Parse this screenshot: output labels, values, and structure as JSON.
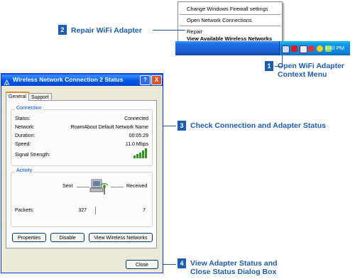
{
  "context_menu": {
    "items": [
      {
        "label": "Change Windows Firewall settings",
        "bold": false
      },
      {
        "label": "Open Network Connections",
        "bold": false
      },
      {
        "label": "Repair",
        "bold": false
      },
      {
        "label": "View Available Wireless Networks",
        "bold": true
      }
    ]
  },
  "taskbar": {
    "clock": "3:40 PM"
  },
  "callouts": [
    {
      "number": "1",
      "text_line1": "Open WiFi Adapter",
      "text_line2": "Context Menu"
    },
    {
      "number": "2",
      "text_line1": "Repair WiFi Adapter"
    },
    {
      "number": "3",
      "text_line1": "Check Connection and Adapter Status"
    },
    {
      "number": "4",
      "text_line1": "View Adapter Status and",
      "text_line2": "Close Status Dialog Box"
    }
  ],
  "dialog": {
    "title": "Wireless Network Connection 2 Status",
    "title_buttons": {
      "help": "?",
      "close": "X"
    },
    "tabs": [
      "General",
      "Support"
    ],
    "connection": {
      "group_title": "Connection",
      "rows": [
        {
          "label": "Status:",
          "value": "Connected"
        },
        {
          "label": "Network:",
          "value": "RoamAbout Default Network Name"
        },
        {
          "label": "Duration:",
          "value": "00:05:29"
        },
        {
          "label": "Speed:",
          "value": "11.0 Mbps"
        },
        {
          "label": "Signal Strength:",
          "value": ""
        }
      ]
    },
    "activity": {
      "group_title": "Activity",
      "sent_label": "Sent",
      "received_label": "Received",
      "packets_label": "Packets:",
      "packets_sent": "327",
      "packets_received": "7"
    },
    "buttons": {
      "properties": "Properties",
      "disable": "Disable",
      "view_networks": "View Wireless Networks",
      "close": "Close"
    }
  },
  "colors": {
    "callout": "#1e5cae",
    "signal": "#2f9a1b"
  }
}
